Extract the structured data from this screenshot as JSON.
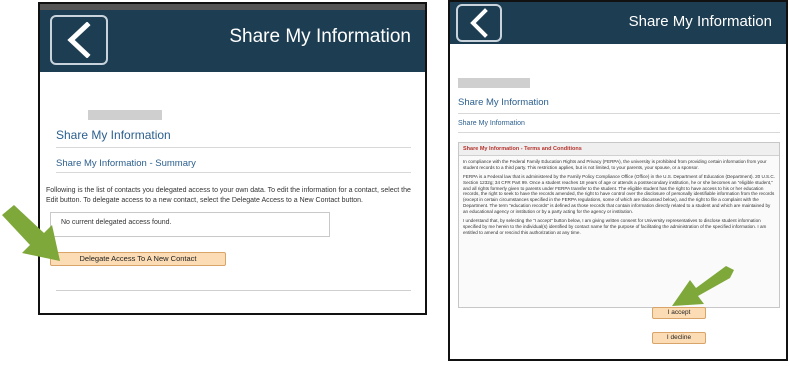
{
  "colors": {
    "header_bg": "#1d3d52",
    "link_blue": "#2b5f8e",
    "button_bg": "#fcdcb4",
    "arrow_green": "#7ea83a",
    "terms_red": "#b5322c"
  },
  "left": {
    "header_title": "Share My Information",
    "page_heading": "Share My Information",
    "section_heading": "Share My Information - Summary",
    "instructions": "Following is the list of contacts you delegated access to your own data. To edit the information for a contact, select the Edit button. To delegate access to a new contact, select the Delegate Access to a New Contact button.",
    "no_data": "No current delegated access found.",
    "delegate_button": "Delegate Access To A New Contact"
  },
  "right": {
    "header_title": "Share My Information",
    "page_heading": "Share My Information",
    "tab_label": "Share My Information",
    "terms_title": "Share My Information - Terms and Conditions",
    "para1": "In compliance with the Federal Family Education Rights and Privacy (FERPA), the university is prohibited from providing certain information from your student records to a third party. This restriction applies, but is not limited, to your parents, your spouse, or a sponsor.",
    "para2": "FERPA is a Federal law that is administered by the Family Policy Compliance Office (Office) in the U.S. Department of Education (Department). 20 U.S.C. Section 1232g; 34 CFR Part 99. Once a student reaches 18 years of age or attends a postsecondary institution, he or she becomes an \"eligible student,\" and all rights formerly given to parents under FERPA transfer to the student. The eligible student has the right to have access to his or her education records, the right to seek to have the records amended, the right to have control over the disclosure of personally identifiable information from the records (except in certain circumstances specified in the FERPA regulations, some of which are discussed below), and the right to file a complaint with the Department. The term \"education records\" is defined as those records that contain information directly related to a student and which are maintained by an educational agency or institution or by a party acting for the agency or institution.",
    "para3": "I understand that, by selecting the \"I accept\" button below, I am giving written consent for University representatives to disclose student information specified by me herein to the individual(s) identified by contact name for the purpose of facilitating the administration of the specified information. I am entitled to amend or rescind this authorization at any time.",
    "accept_button": "I accept",
    "decline_button": "I decline"
  },
  "icons": {
    "back": "chevron-left-icon",
    "pointer": "green-arrow-icon"
  }
}
